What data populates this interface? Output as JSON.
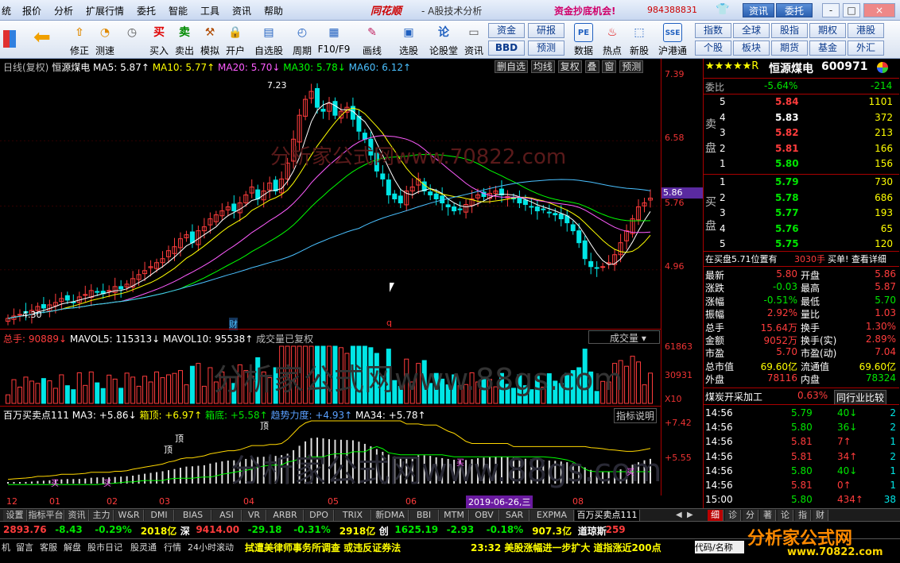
{
  "menu": [
    "统",
    "报价",
    "分析",
    "扩展行情",
    "委托",
    "智能",
    "工具",
    "资讯",
    "帮助"
  ],
  "brand": "同花顺",
  "brand_sub": "- A股技术分析",
  "promo": "资金抄底机会!",
  "phone": "984388831",
  "top_buttons": {
    "news": "资讯",
    "trade": "委托"
  },
  "window_controls": {
    "min": "-",
    "max": "□",
    "close": "×"
  },
  "tools": [
    {
      "label": "修正",
      "icon": "up-arrow-icon"
    },
    {
      "label": "测速",
      "icon": "speedometer-icon"
    },
    {
      "label": "买入",
      "icon": "buy-icon",
      "glyph": "买"
    },
    {
      "label": "卖出",
      "icon": "sell-icon",
      "glyph": "卖"
    },
    {
      "label": "模拟",
      "icon": "hammer-icon"
    },
    {
      "label": "开户",
      "icon": "lock-icon"
    },
    {
      "label": "自选股",
      "icon": "watchlist-icon"
    },
    {
      "label": "周期",
      "icon": "clock-icon"
    },
    {
      "label": "F10/F9",
      "icon": "f10-icon"
    },
    {
      "label": "画线",
      "icon": "pencil-icon"
    },
    {
      "label": "选股",
      "icon": "screen-icon"
    },
    {
      "label": "论股堂",
      "icon": "forum-icon"
    },
    {
      "label": "资讯",
      "icon": "news-icon"
    },
    {
      "label": "数据",
      "icon": "pe-icon",
      "glyph": "PE"
    },
    {
      "label": "热点",
      "icon": "hot-icon"
    },
    {
      "label": "新股",
      "icon": "new-stock-icon"
    },
    {
      "label": "沪港通",
      "icon": "hk-connect-icon",
      "glyph": "SSE"
    }
  ],
  "gbuttons_left": [
    [
      "资金",
      "研报"
    ],
    [
      "BBD",
      "预测"
    ]
  ],
  "gbuttons_right": [
    [
      "指数",
      "全球",
      "股指",
      "期权",
      "港股"
    ],
    [
      "个股",
      "板块",
      "期货",
      "基金",
      "外汇"
    ]
  ],
  "chart_header": {
    "period": "日线(复权)",
    "name": "恒源煤电",
    "ma5": "MA5: 5.87↑",
    "ma10": "MA10: 5.77↑",
    "ma20": "MA20: 5.70↓",
    "ma30": "MA30: 5.78↓",
    "ma60": "MA60: 6.12↑",
    "buttons": [
      "删自选",
      "均线",
      "复权",
      "叠",
      "窗",
      "预测"
    ]
  },
  "price_axis": [
    "7.39",
    "6.58",
    "5.76",
    "4.96"
  ],
  "price_marker": "5.86",
  "hi_label": "7.23",
  "lo_label": "4.30",
  "markers": {
    "fin": "财",
    "q": "q"
  },
  "volume_header": {
    "total": "总手: 90889↓",
    "mavol5": "MAVOL5: 115313↓",
    "mavol10": "MAVOL10: 95538↑",
    "note": "成交量已复权",
    "selector": "成交量"
  },
  "volume_axis": [
    "61863",
    "30931",
    "X10"
  ],
  "ind_header": {
    "name": "百万买卖点111",
    "ma3": "MA3: +5.86↓",
    "top": "箱顶: +6.97↑",
    "bottom": "箱底: +5.58↑",
    "trend": "趋势力度: +4.93↑",
    "ma34": "MA34: +5.78↑",
    "explain": "指标说明"
  },
  "ind_axis": [
    "+7.42",
    "+5.55"
  ],
  "ind_labels": [
    "顶",
    "顶",
    "顶",
    "买",
    "买",
    "买",
    "买"
  ],
  "date_axis": [
    "12",
    "01",
    "02",
    "03",
    "04",
    "05",
    "06",
    "07",
    "08"
  ],
  "date_cursor": "2019-06-26,三",
  "watermark": {
    "top": "分析家公式网www.70822.com",
    "mid": "分析家公式网www.88gs.com",
    "bottom": "分析家公式网www.88gs.com"
  },
  "chart_data": {
    "type": "candlestick",
    "title": "恒源煤电 日线(复权)",
    "x_months": [
      "12",
      "01",
      "02",
      "03",
      "04",
      "05",
      "06",
      "07",
      "08"
    ],
    "ylim": [
      4.3,
      7.39
    ],
    "closes": [
      4.35,
      4.38,
      4.4,
      4.42,
      4.45,
      4.5,
      4.48,
      4.52,
      4.55,
      4.6,
      4.58,
      4.55,
      4.62,
      4.65,
      4.7,
      4.68,
      4.66,
      4.7,
      4.75,
      4.72,
      4.78,
      4.85,
      4.9,
      4.95,
      5.0,
      5.05,
      5.1,
      5.2,
      5.25,
      5.35,
      5.4,
      5.3,
      5.45,
      5.5,
      5.6,
      5.65,
      5.7,
      5.75,
      5.7,
      5.8,
      5.9,
      6.0,
      5.85,
      5.95,
      6.05,
      5.95,
      6.1,
      6.3,
      6.6,
      6.9,
      7.1,
      7.2,
      7.0,
      6.95,
      7.05,
      6.9,
      6.95,
      7.0,
      6.85,
      6.7,
      6.6,
      6.4,
      6.2,
      6.1,
      5.9,
      5.85,
      5.8,
      5.95,
      6.0,
      6.1,
      5.95,
      5.9,
      5.85,
      5.8,
      5.75,
      5.7,
      5.72,
      5.78,
      5.85,
      5.9,
      5.88,
      5.92,
      5.95,
      5.9,
      5.88,
      5.85,
      5.8,
      5.78,
      5.75,
      5.7,
      5.72,
      5.68,
      5.65,
      5.6,
      5.55,
      5.45,
      5.3,
      5.1,
      5.0,
      4.98,
      5.0,
      5.05,
      5.15,
      5.3,
      5.45,
      5.6,
      5.75,
      5.8,
      5.86
    ],
    "volume_axis_max": 61863,
    "series": [
      {
        "name": "MA5",
        "value": 5.87
      },
      {
        "name": "MA10",
        "value": 5.77
      },
      {
        "name": "MA20",
        "value": 5.7
      },
      {
        "name": "MA30",
        "value": 5.78
      },
      {
        "name": "MA60",
        "value": 6.12
      }
    ]
  },
  "quote": {
    "stars": "★★★★★R",
    "name": "恒源煤电",
    "code": "600971",
    "webi_label": "委比",
    "webi": "-5.64%",
    "webi_diff": "-214",
    "sell_label": "卖盘",
    "buy_label": "买盘",
    "sells": [
      [
        "5",
        "5.84",
        "1101"
      ],
      [
        "4",
        "5.83",
        "372"
      ],
      [
        "3",
        "5.82",
        "213"
      ],
      [
        "2",
        "5.81",
        "166"
      ],
      [
        "1",
        "5.80",
        "156"
      ]
    ],
    "buys": [
      [
        "1",
        "5.79",
        "730"
      ],
      [
        "2",
        "5.78",
        "686"
      ],
      [
        "3",
        "5.77",
        "193"
      ],
      [
        "4",
        "5.76",
        "65"
      ],
      [
        "5",
        "5.75",
        "120"
      ]
    ],
    "notice_a": "在买盘5.71位置有",
    "notice_b": "3030手",
    "notice_c": "买单! 查看详细",
    "stats": [
      [
        "最新",
        "5.80",
        "开盘",
        "5.86"
      ],
      [
        "涨跌",
        "-0.03",
        "最高",
        "5.87"
      ],
      [
        "涨幅",
        "-0.51%",
        "最低",
        "5.70"
      ],
      [
        "振幅",
        "2.92%",
        "量比",
        "1.03"
      ],
      [
        "总手",
        "15.64万",
        "换手",
        "1.30%"
      ],
      [
        "金额",
        "9052万",
        "换手(实)",
        "2.89%"
      ],
      [
        "市盈",
        "5.70",
        "市盈(动)",
        "7.04"
      ],
      [
        "总市值",
        "69.60亿",
        "流通值",
        "69.60亿"
      ],
      [
        "外盘",
        "78116",
        "内盘",
        "78324"
      ]
    ],
    "industry": "煤炭开采加工",
    "industry_pct": "0.63%",
    "industry_btn": "同行业比较",
    "ticks": [
      [
        "14:56",
        "5.79",
        "40↓",
        "2"
      ],
      [
        "14:56",
        "5.80",
        "36↓",
        "2"
      ],
      [
        "14:56",
        "5.81",
        "7↑",
        "1"
      ],
      [
        "14:56",
        "5.81",
        "34↑",
        "2"
      ],
      [
        "14:56",
        "5.80",
        "40↓",
        "1"
      ],
      [
        "14:56",
        "5.81",
        "0↑",
        "1"
      ],
      [
        "15:00",
        "5.80",
        "434↑",
        "38"
      ]
    ]
  },
  "tabs": [
    "设置",
    "指标平台",
    "资讯",
    "主力",
    "W&R",
    "DMI",
    "BIAS",
    "ASI",
    "VR",
    "ARBR",
    "DPO",
    "TRIX",
    "新DMA",
    "BBI",
    "MTM",
    "OBV",
    "SAR",
    "EXPMA",
    "百万买卖点111"
  ],
  "right_tabs": [
    "细",
    "诊",
    "分",
    "著",
    "论",
    "指",
    "财"
  ],
  "index_bar": [
    {
      "t": "2893.76",
      "c": "red"
    },
    {
      "t": "-8.43",
      "c": "grn"
    },
    {
      "t": "-0.29%",
      "c": "grn"
    },
    {
      "t": "2018亿",
      "c": "yel"
    },
    {
      "t": "深",
      "c": "wht"
    },
    {
      "t": "9414.00",
      "c": "red"
    },
    {
      "t": "-29.18",
      "c": "grn"
    },
    {
      "t": "-0.31%",
      "c": "grn"
    },
    {
      "t": "2918亿",
      "c": "yel"
    },
    {
      "t": "创",
      "c": "wht"
    },
    {
      "t": "1625.19",
      "c": "grn"
    },
    {
      "t": "-2.93",
      "c": "grn"
    },
    {
      "t": "-0.18%",
      "c": "grn"
    },
    {
      "t": "907.3亿",
      "c": "yel"
    },
    {
      "t": "道琼斯",
      "c": "wht"
    },
    {
      "t": "259",
      "c": "red"
    }
  ],
  "status_items": [
    "机",
    "留言",
    "客服",
    "解盘",
    "股市日记",
    "股灵通",
    "行情",
    "24小时滚动"
  ],
  "news1": "拭遭美律师事务所调查 或违反证券法",
  "news2": "23:32 美股涨幅进一步扩大 道指涨近200点",
  "status_right": "代码/名称",
  "logo": "分析家公式网",
  "logo_url": "www.70822.com"
}
